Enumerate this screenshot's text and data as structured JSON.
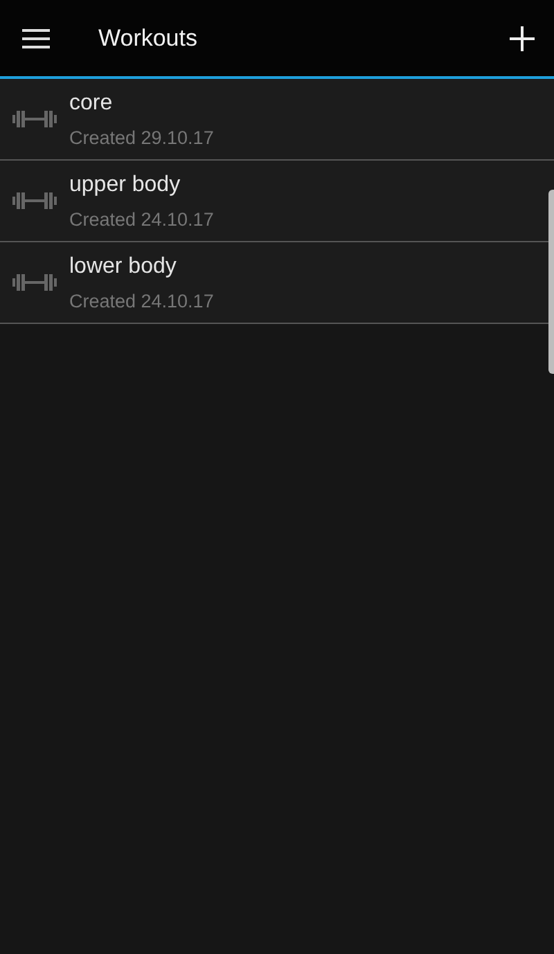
{
  "app_bar": {
    "title": "Workouts"
  },
  "workouts": [
    {
      "name": "core",
      "created": "Created 29.10.17"
    },
    {
      "name": "upper body",
      "created": "Created 24.10.17"
    },
    {
      "name": "lower body",
      "created": "Created 24.10.17"
    }
  ]
}
